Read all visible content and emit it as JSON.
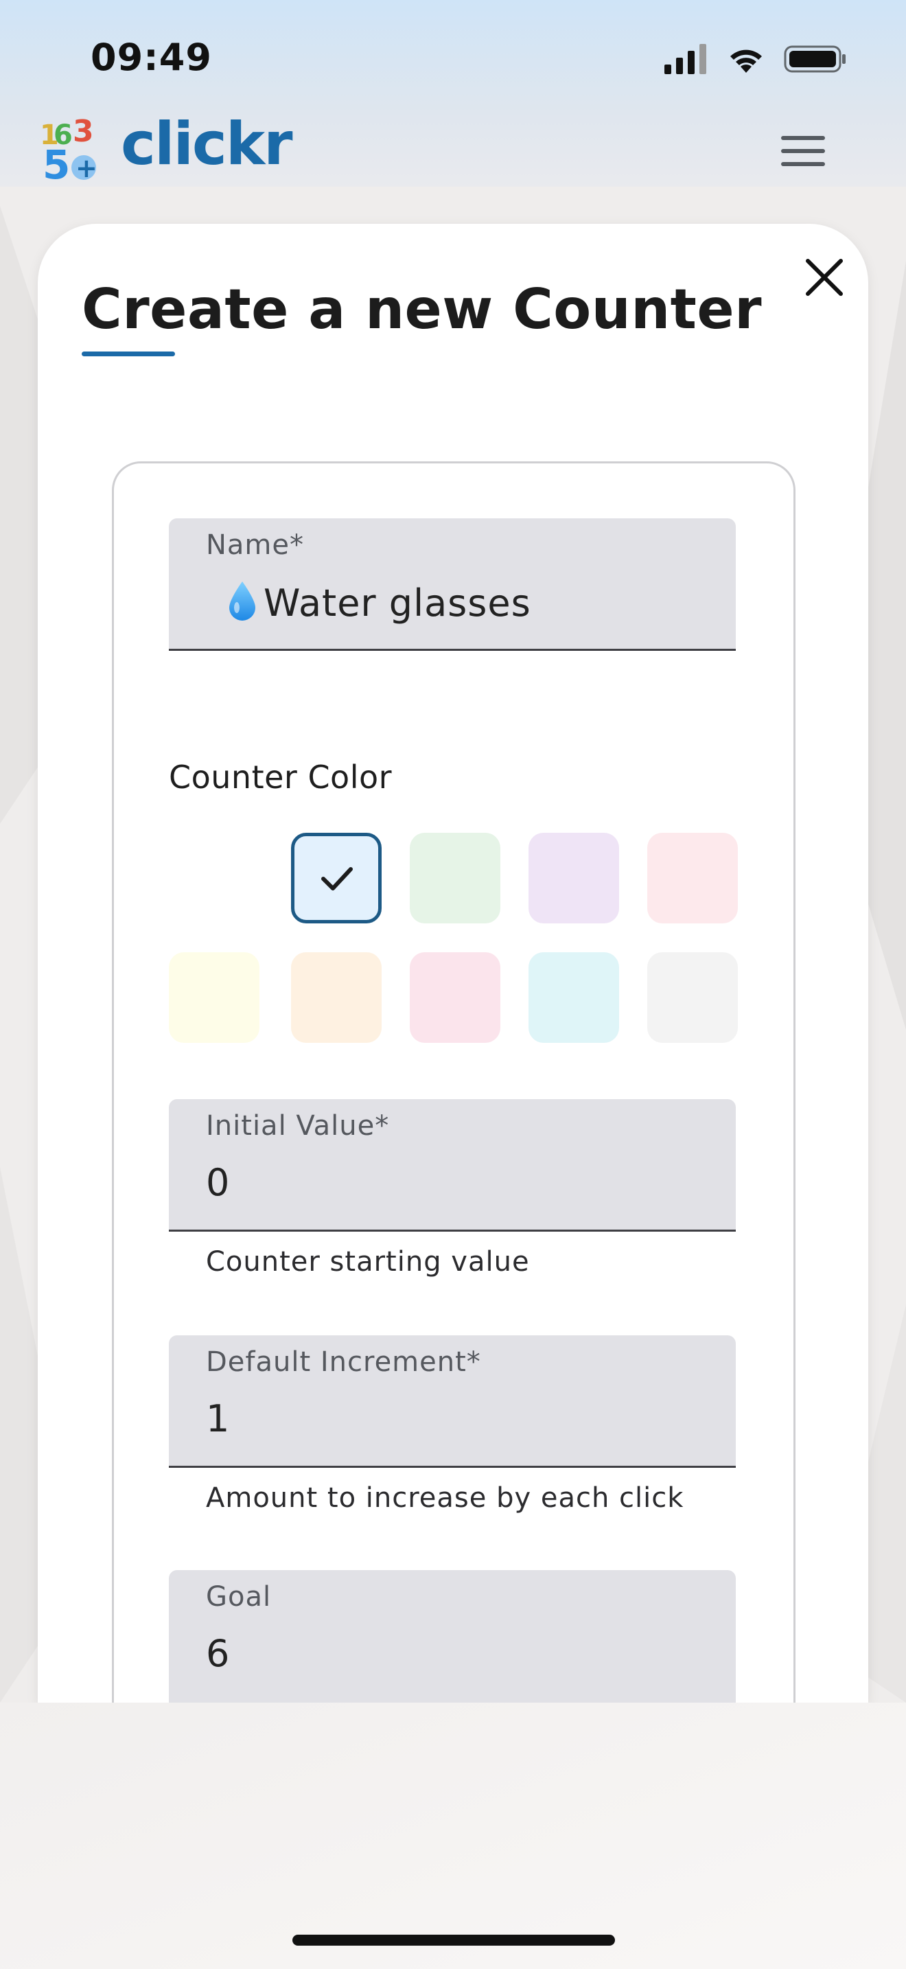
{
  "status_bar": {
    "time": "09:49"
  },
  "header": {
    "app_name": "clickr",
    "logo_digits": [
      "1",
      "6",
      "3",
      "5",
      "+"
    ]
  },
  "modal": {
    "title": "Create a new Counter",
    "name_field": {
      "label": "Name*",
      "value": "💧Water glasses",
      "value_text": "Water glasses"
    },
    "color_section": {
      "label": "Counter Color",
      "swatches": [
        {
          "color": "#e3f1fd",
          "selected": true
        },
        {
          "color": "#e6f4e7",
          "selected": false
        },
        {
          "color": "#efe4f6",
          "selected": false
        },
        {
          "color": "#fde9ec",
          "selected": false
        },
        {
          "color": "#fefde8",
          "selected": false
        },
        {
          "color": "#fef1e1",
          "selected": false
        },
        {
          "color": "#fbe4ec",
          "selected": false
        },
        {
          "color": "#dff5f8",
          "selected": false
        },
        {
          "color": "#f3f3f3",
          "selected": false
        }
      ]
    },
    "initial_value_field": {
      "label": "Initial Value*",
      "value": "0",
      "helper": "Counter starting value"
    },
    "increment_field": {
      "label": "Default Increment*",
      "value": "1",
      "helper": "Amount to increase by each click"
    },
    "goal_field": {
      "label": "Goal",
      "value": "6"
    }
  },
  "colors": {
    "accent": "#1b6aa8",
    "selected_border": "#1d5a86"
  }
}
